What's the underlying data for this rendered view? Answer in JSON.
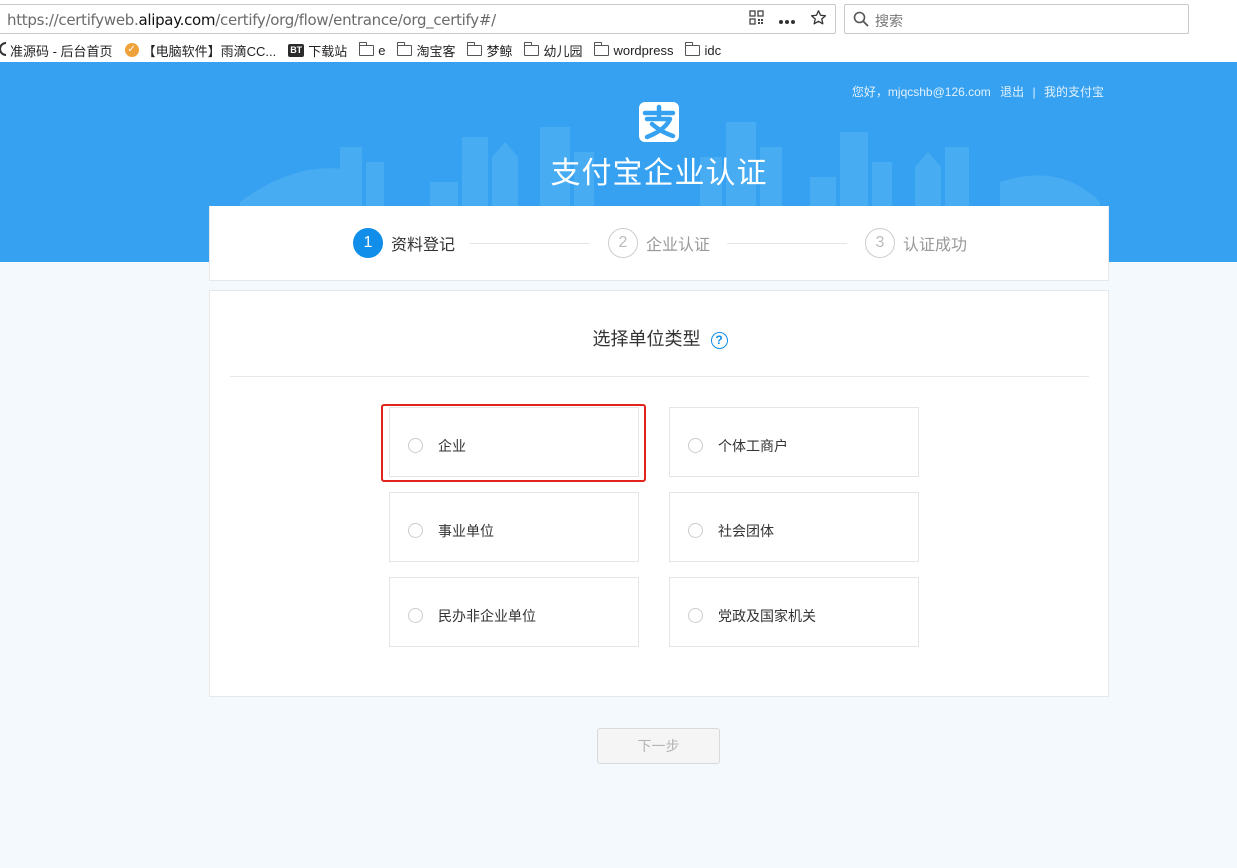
{
  "browser": {
    "url_prefix": "https://certifyweb.",
    "url_domain": "alipay.com",
    "url_suffix": "/certify/org/flow/entrance/org_certify#/",
    "search_placeholder": "搜索",
    "icons": [
      "qr-code-icon",
      "more-icon",
      "star-icon",
      "search-icon"
    ]
  },
  "bookmarks": [
    {
      "label": "准源码 - 后台首页",
      "icon": "site-icon"
    },
    {
      "label": "【电脑软件】雨滴CC...",
      "icon": "shield-icon"
    },
    {
      "label": "下载站",
      "icon": "bt-icon"
    },
    {
      "label": "e",
      "icon": "folder-icon"
    },
    {
      "label": "淘宝客",
      "icon": "folder-icon"
    },
    {
      "label": "梦鲸",
      "icon": "folder-icon"
    },
    {
      "label": "幼儿园",
      "icon": "folder-icon"
    },
    {
      "label": "wordpress",
      "icon": "folder-icon"
    },
    {
      "label": "idc",
      "icon": "folder-icon"
    }
  ],
  "header": {
    "greeting": "您好，mjqcshb@126.com",
    "logout": "退出",
    "separator": "|",
    "my_alipay": "我的支付宝",
    "title": "支付宝企业认证",
    "logo_char": "支"
  },
  "steps": [
    {
      "num": "1",
      "label": "资料登记",
      "active": true
    },
    {
      "num": "2",
      "label": "企业认证",
      "active": false
    },
    {
      "num": "3",
      "label": "认证成功",
      "active": false
    }
  ],
  "main": {
    "title": "选择单位类型",
    "help_glyph": "?",
    "options": [
      {
        "label": "企业",
        "selected": false,
        "highlighted": true
      },
      {
        "label": "个体工商户",
        "selected": false
      },
      {
        "label": "事业单位",
        "selected": false
      },
      {
        "label": "社会团体",
        "selected": false
      },
      {
        "label": "民办非企业单位",
        "selected": false
      },
      {
        "label": "党政及国家机关",
        "selected": false
      }
    ]
  },
  "next_button": "下一步",
  "colors": {
    "hero_blue": "#36a1f0",
    "accent_blue": "#108ee9",
    "highlight_red": "#e0241c"
  }
}
